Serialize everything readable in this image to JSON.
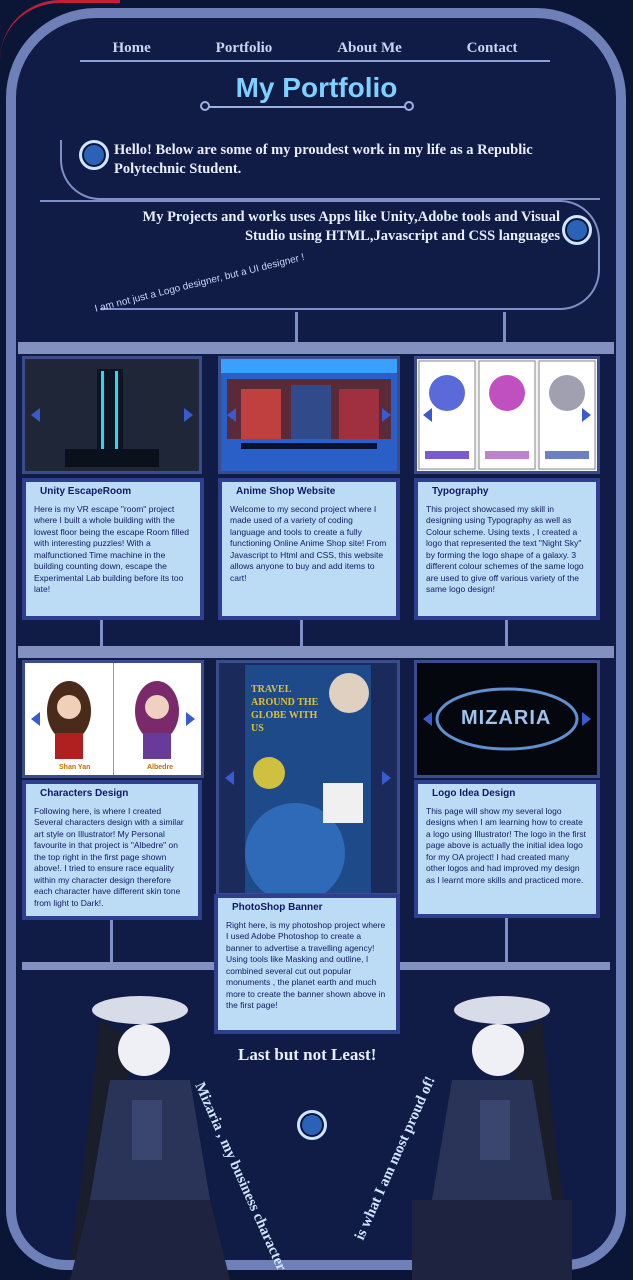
{
  "nav": [
    "Home",
    "Portfolio",
    "About Me",
    "Contact"
  ],
  "title": "My Portfolio",
  "intro1": "Hello! Below are some of my proudest work in my life as a Republic Polytechnic Student.",
  "intro2": "My Projects and works uses Apps like Unity,Adobe tools and Visual Studio using HTML,Javascript and CSS languages",
  "tagline": "I am not just a Logo designer, but a UI designer !",
  "projects": [
    {
      "title": "Unity EscapeRoom",
      "text": "Here is my VR escape \"room\" project where I built a whole building with the lowest floor being the escape Room filled with interesting puzzles! With a malfunctioned Time machine in the building counting down, escape the Experimental Lab building before its too late!"
    },
    {
      "title": "Anime Shop Website",
      "text": "Welcome to my second project where I made used of a variety of coding language and tools to create a fully functioning Online Anime Shop site! From Javascript to Html and CSS, this website allows anyone to buy and add items to cart!"
    },
    {
      "title": "Typography",
      "text": "This project showcased my skill in designing using Typography as well as Colour scheme. Using texts , I created a logo that represented the text \"Night Sky\" by forming the logo shape of a galaxy. 3 different colour schemes of the same logo are used to give off various variety of the same logo design!"
    },
    {
      "title": "Characters Design",
      "text": "Following here, is where I created Several characters design with a similar art style on Illustrator! My Personal favourite in that project is \"Albedre\" on the top right in the first page shown above!. I tried to ensure race equality within my character design therefore each character have different skin tone from light to Dark!."
    },
    {
      "title": "PhotoShop Banner",
      "text": "Right here, is my photoshop project where I used Adobe Photoshop to create a banner to advertise a travelling agency! Using tools like Masking and outline, I combined several cut out popular monuments , the planet earth and much more to create the banner shown above in the first page!"
    },
    {
      "title": "Logo Idea Design",
      "text": "This page will show my several logo designs when I am learning how to create a logo using Illustrator! The logo in the first page above is actually the initial idea logo for my OA project! I had created many other logos and had improved my design as I learnt more skills and practiced more."
    }
  ],
  "image_labels": {
    "char1": "Shan Yan",
    "char2": "Albedre",
    "banner": "TRAVEL AROUND THE GLOBE WITH US",
    "logo": "MIZARIA"
  },
  "last_title": "Last but not Least!",
  "curve_left": "Mizaria , my business character",
  "curve_right": "is what I am most proud of!",
  "colors": {
    "accent": "#7fd0ff",
    "card": "#bcdcf6",
    "card_border": "#2f3f90",
    "frame": "#6f7fb8"
  }
}
